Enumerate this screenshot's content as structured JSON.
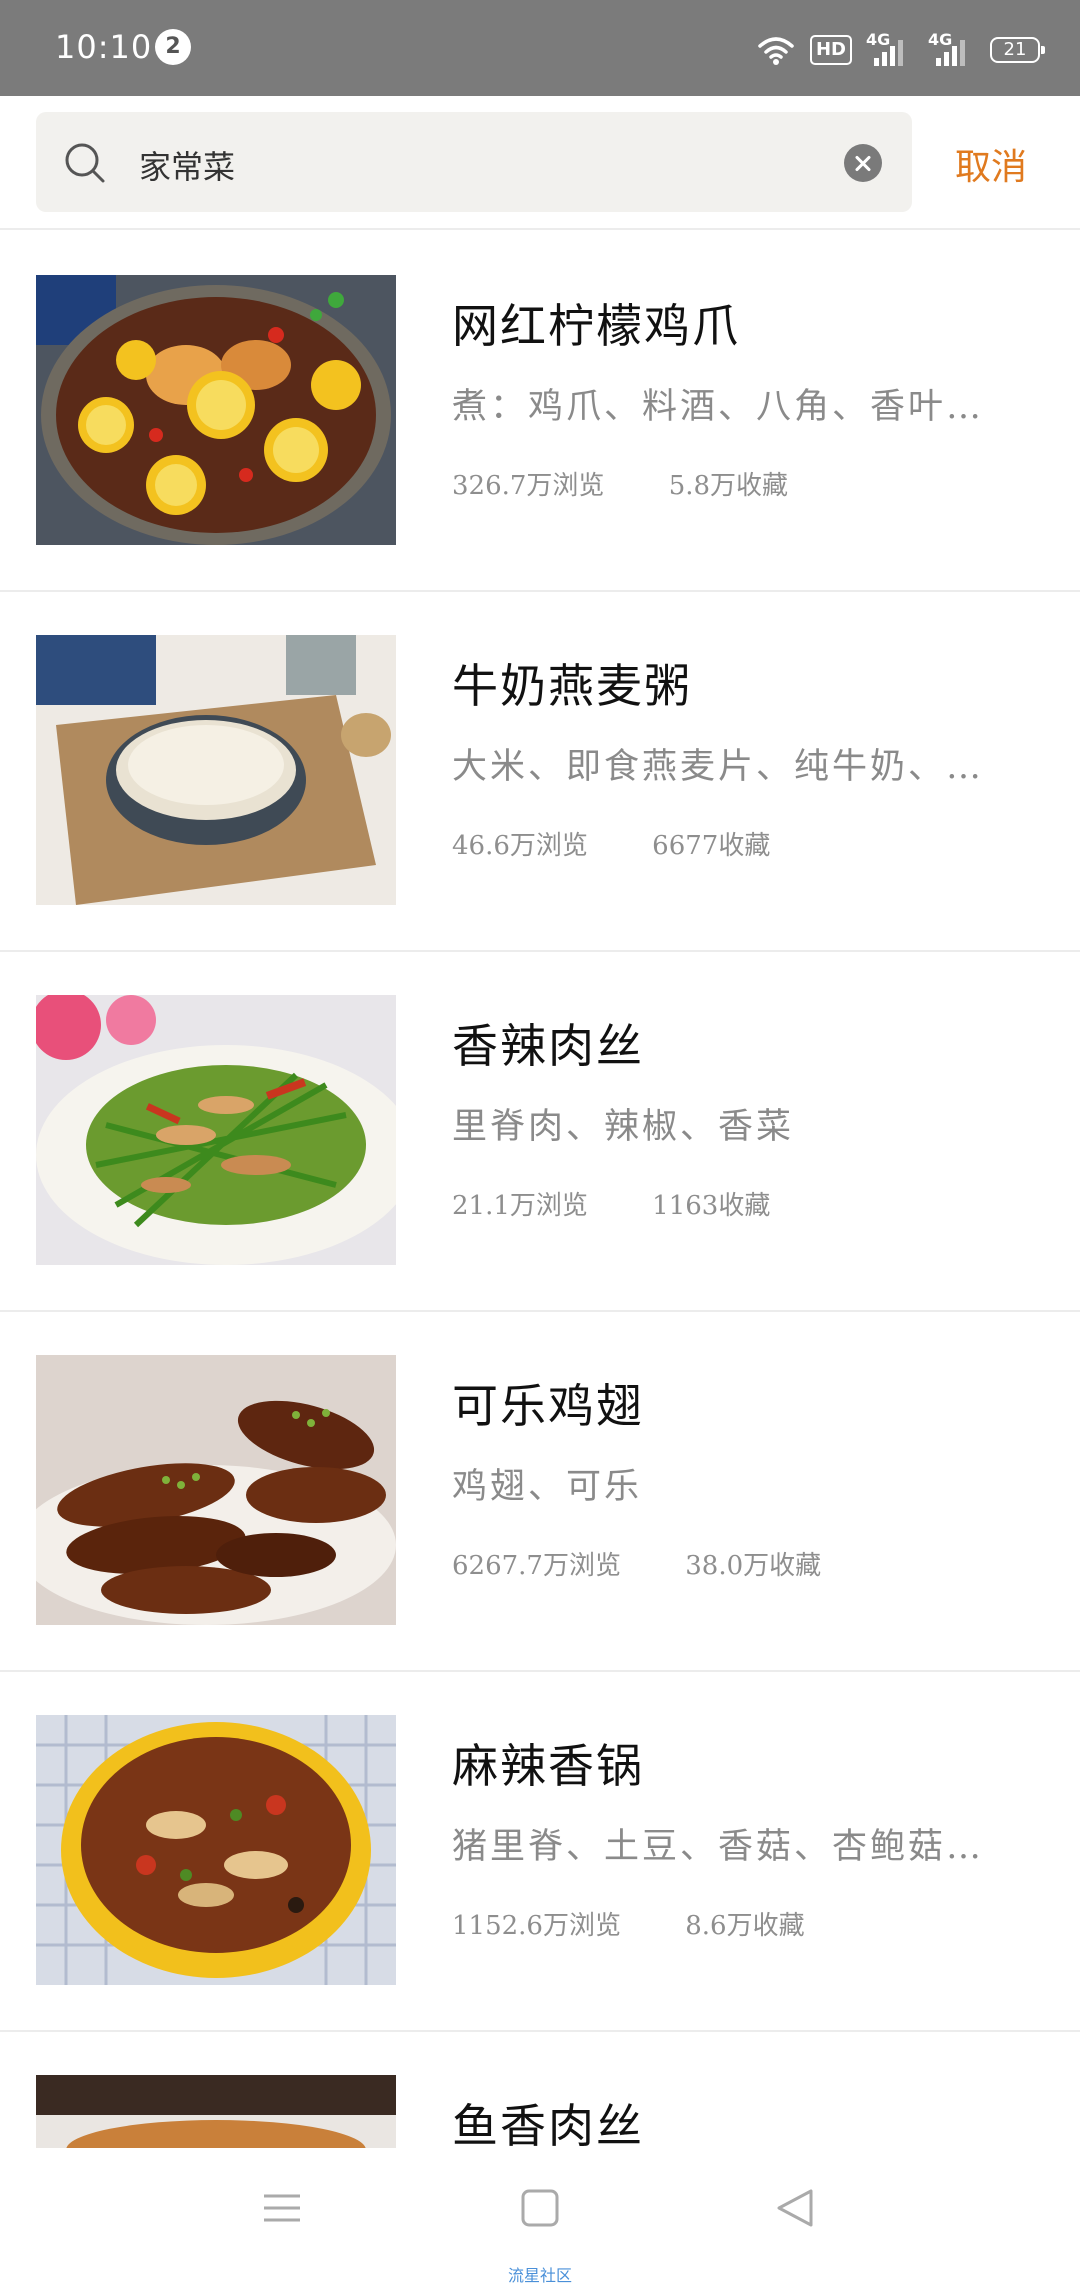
{
  "status_bar": {
    "time": "10:10",
    "notification_count": "2",
    "hd_label": "HD",
    "network_1": "4G",
    "network_2": "4G",
    "battery": "21"
  },
  "search": {
    "query": "家常菜",
    "cancel_label": "取消"
  },
  "recipes": [
    {
      "title": "网红柠檬鸡爪",
      "ingredients": "煮：鸡爪、料酒、八角、香叶…",
      "views": "326.7万浏览",
      "favorites": "5.8万收藏"
    },
    {
      "title": "牛奶燕麦粥",
      "ingredients": "大米、即食燕麦片、纯牛奶、…",
      "views": "46.6万浏览",
      "favorites": "6677收藏"
    },
    {
      "title": "香辣肉丝",
      "ingredients": "里脊肉、辣椒、香菜",
      "views": "21.1万浏览",
      "favorites": "1163收藏"
    },
    {
      "title": "可乐鸡翅",
      "ingredients": "鸡翅、可乐",
      "views": "6267.7万浏览",
      "favorites": "38.0万收藏"
    },
    {
      "title": "麻辣香锅",
      "ingredients": "猪里脊、土豆、香菇、杏鲍菇…",
      "views": "1152.6万浏览",
      "favorites": "8.6万收藏"
    },
    {
      "title": "鱼香肉丝"
    }
  ],
  "nav": {
    "watermark": "流星社区"
  },
  "colors": {
    "accent": "#e07a1f",
    "status_bar": "#7b7b7b"
  }
}
